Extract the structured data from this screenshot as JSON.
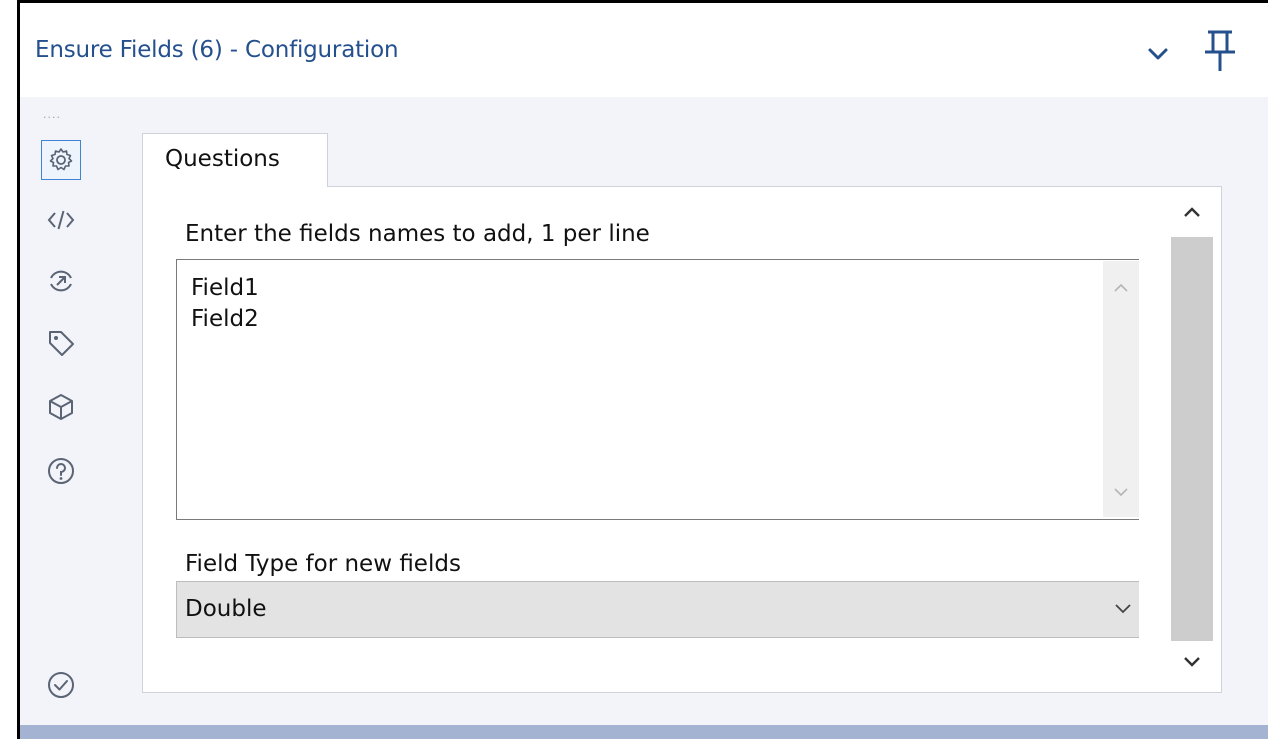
{
  "window": {
    "title": "Ensure Fields (6) - Configuration",
    "collapse_icon": "chevron-down-icon",
    "pin_icon": "pin-icon"
  },
  "sidebar": {
    "items": [
      {
        "icon": "gear-icon",
        "label": "Configuration",
        "active": true
      },
      {
        "icon": "code-icon",
        "label": "Code"
      },
      {
        "icon": "export-icon",
        "label": "Export"
      },
      {
        "icon": "tag-icon",
        "label": "Tag"
      },
      {
        "icon": "package-icon",
        "label": "Package"
      },
      {
        "icon": "help-icon",
        "label": "Help"
      },
      {
        "icon": "check-circle-icon",
        "label": "Validate"
      }
    ],
    "accent_color": "#3f83d4"
  },
  "tabs": [
    {
      "label": "Questions",
      "active": true
    }
  ],
  "form": {
    "fields_label": "Enter the fields names to add, 1 per line",
    "fields_value": "Field1\nField2",
    "type_label": "Field Type for new fields",
    "type_value": "Double"
  },
  "colors": {
    "title": "#24508d",
    "body_background": "#f2f4f9",
    "bottom_strip": "#a5b3d3"
  }
}
